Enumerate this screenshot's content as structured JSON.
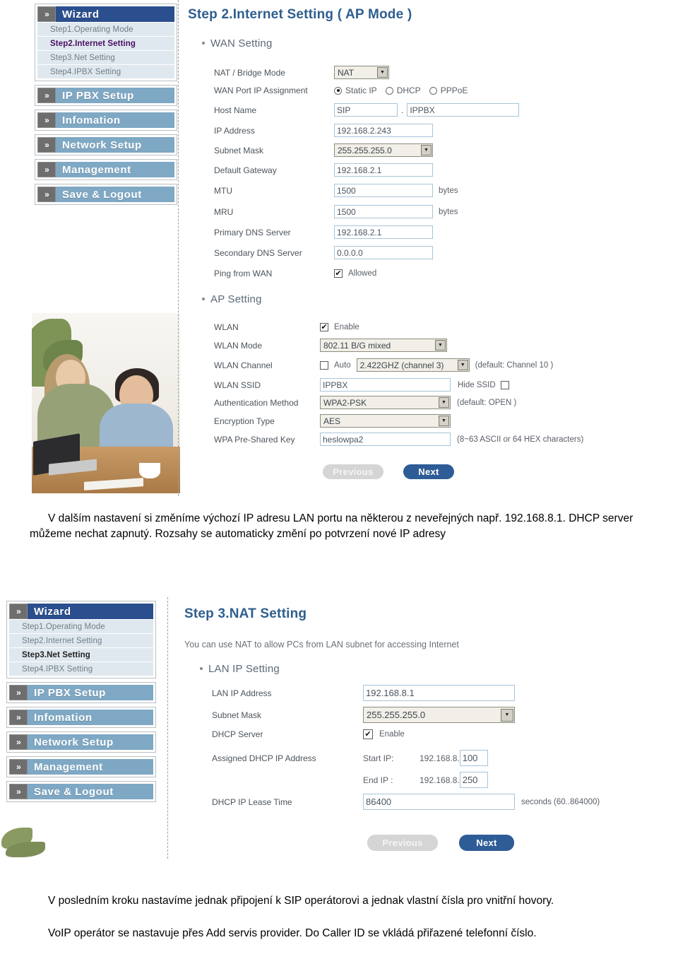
{
  "document": {
    "language": "cs",
    "paragraphs": [
      "V dalším nastavení si změníme výchozí IP adresu LAN portu na některou z neveřejných např. 192.168.8.1. DHCP server můžeme nechat zapnutý. Rozsahy se automaticky změní po potvrzení nové IP adresy",
      "V posledním kroku nastavíme jednak připojení k SIP operátorovi a jednak vlastní čísla pro vnitřní hovory.",
      "VoIP operátor se nastavuje přes Add servis provider. Do Caller ID se vkládá přiřazené telefonní číslo."
    ]
  },
  "colors": {
    "menu_active": "#2b4f8e",
    "menu_plain": "#7fa8c4",
    "submenu_bg": "#dfe8ef",
    "chevron_bg": "#6e6e6e",
    "title_blue": "#2f5e8e",
    "next_button": "#2e5c97",
    "previous_button": "#d5d5d5",
    "field_border": "#a8c4d8",
    "select_bg": "#f1efe8"
  },
  "screenshot1": {
    "sidebar": {
      "groups": [
        {
          "label": "Wizard",
          "state": "active",
          "chevron": "»",
          "items": [
            {
              "label": "Step1.Operating Mode",
              "current": false
            },
            {
              "label": "Step2.Internet Setting",
              "current": true
            },
            {
              "label": "Step3.Net Setting",
              "current": false
            },
            {
              "label": "Step4.IPBX Setting",
              "current": false
            }
          ]
        },
        {
          "label": "IP PBX Setup",
          "state": "plain",
          "chevron": "»",
          "items": []
        },
        {
          "label": "Infomation",
          "state": "plain",
          "chevron": "»",
          "items": []
        },
        {
          "label": "Network Setup",
          "state": "plain",
          "chevron": "»",
          "items": []
        },
        {
          "label": "Management",
          "state": "plain",
          "chevron": "»",
          "items": []
        },
        {
          "label": "Save & Logout",
          "state": "plain",
          "chevron": "»",
          "items": []
        }
      ]
    },
    "page_title": "Step 2.Internet Setting ( AP Mode )",
    "wan": {
      "section_label": "WAN Setting",
      "nat_bridge_mode": {
        "label": "NAT / Bridge Mode",
        "value": "NAT"
      },
      "wan_port_ip_assignment": {
        "label": "WAN Port IP Assignment",
        "options": [
          "Static IP",
          "DHCP",
          "PPPoE"
        ],
        "selected": "Static IP"
      },
      "host_name": {
        "label": "Host Name",
        "value1": "SIP",
        "separator": ".",
        "value2": "IPPBX"
      },
      "ip_address": {
        "label": "IP Address",
        "value": "192.168.2.243"
      },
      "subnet_mask": {
        "label": "Subnet Mask",
        "value": "255.255.255.0"
      },
      "default_gateway": {
        "label": "Default Gateway",
        "value": "192.168.2.1"
      },
      "mtu": {
        "label": "MTU",
        "value": "1500",
        "unit": "bytes"
      },
      "mru": {
        "label": "MRU",
        "value": "1500",
        "unit": "bytes"
      },
      "primary_dns": {
        "label": "Primary DNS Server",
        "value": "192.168.2.1"
      },
      "secondary_dns": {
        "label": "Secondary DNS Server",
        "value": "0.0.0.0"
      },
      "ping_from_wan": {
        "label": "Ping from WAN",
        "checkbox_label": "Allowed",
        "checked": true
      }
    },
    "ap": {
      "section_label": "AP Setting",
      "wlan": {
        "label": "WLAN",
        "checkbox_label": "Enable",
        "checked": true
      },
      "wlan_mode": {
        "label": "WLAN Mode",
        "value": "802.11 B/G mixed"
      },
      "wlan_channel": {
        "label": "WLAN Channel",
        "auto_label": "Auto",
        "auto_checked": false,
        "value": "2.422GHZ (channel 3)",
        "hint": "(default: Channel 10 )"
      },
      "wlan_ssid": {
        "label": "WLAN SSID",
        "value": "IPPBX",
        "hide_label": "Hide SSID",
        "hide_checked": false
      },
      "auth_method": {
        "label": "Authentication Method",
        "value": "WPA2-PSK",
        "hint": "(default: OPEN )"
      },
      "encryption_type": {
        "label": "Encryption Type",
        "value": "AES"
      },
      "wpa_key": {
        "label": "WPA Pre-Shared Key",
        "value": "heslowpa2",
        "hint": "(8~63 ASCII or 64 HEX characters)"
      }
    },
    "buttons": {
      "previous": "Previous",
      "next": "Next"
    }
  },
  "screenshot2": {
    "sidebar": {
      "groups": [
        {
          "label": "Wizard",
          "state": "active",
          "chevron": "»",
          "items": [
            {
              "label": "Step1.Operating Mode",
              "current": false
            },
            {
              "label": "Step2.Internet Setting",
              "current": false
            },
            {
              "label": "Step3.Net Setting",
              "current": true
            },
            {
              "label": "Step4.IPBX Setting",
              "current": false
            }
          ]
        },
        {
          "label": "IP PBX Setup",
          "state": "plain",
          "chevron": "»",
          "items": []
        },
        {
          "label": "Infomation",
          "state": "plain",
          "chevron": "»",
          "items": []
        },
        {
          "label": "Network Setup",
          "state": "plain",
          "chevron": "»",
          "items": []
        },
        {
          "label": "Management",
          "state": "plain",
          "chevron": "»",
          "items": []
        },
        {
          "label": "Save & Logout",
          "state": "plain",
          "chevron": "»",
          "items": []
        }
      ]
    },
    "page_title": "Step 3.NAT Setting",
    "page_subtitle": "You can use NAT to allow PCs from LAN subnet for accessing Internet",
    "lan": {
      "section_label": "LAN IP Setting",
      "lan_ip_address": {
        "label": "LAN IP Address",
        "value": "192.168.8.1"
      },
      "subnet_mask": {
        "label": "Subnet Mask",
        "value": "255.255.255.0"
      },
      "dhcp_server": {
        "label": "DHCP Server",
        "checkbox_label": "Enable",
        "checked": true
      },
      "assigned_dhcp": {
        "label": "Assigned DHCP IP Address",
        "start_label": "Start IP:",
        "start_prefix": "192.168.8.",
        "start_value": "100",
        "end_label": "End IP :",
        "end_prefix": "192.168.8.",
        "end_value": "250"
      },
      "lease_time": {
        "label": "DHCP IP Lease Time",
        "value": "86400",
        "unit": "seconds (60..864000)"
      }
    },
    "buttons": {
      "previous": "Previous",
      "next": "Next"
    }
  }
}
